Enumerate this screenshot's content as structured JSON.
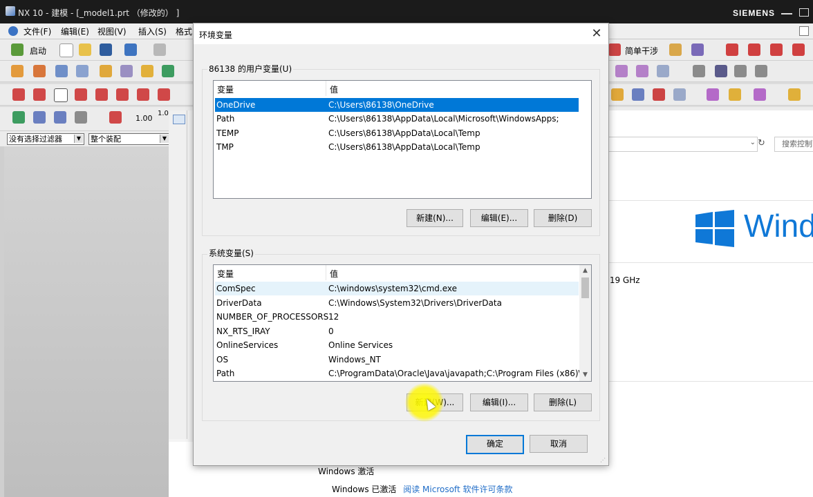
{
  "nx_window": {
    "title": "NX 10 - 建模 - [_model1.prt （修改的） ]",
    "brand": "SIEMENS",
    "menu": [
      "文件(F)",
      "编辑(E)",
      "视图(V)",
      "插入(S)",
      "格式"
    ],
    "toolbar": {
      "start_label": "启动",
      "simple_interference": "简单干涉",
      "scale_a": "1.00",
      "scale_b": "1.00"
    },
    "filter": {
      "selection_filter": "没有选择过滤器",
      "scope": "整个装配"
    }
  },
  "background_window": {
    "search_placeholder": "搜索控制面板",
    "windows_logo_text": "Wind",
    "cpu_speed_fragment": ".19 GHz",
    "activation_title": "Windows 激活",
    "activation_status": "Windows 已激活",
    "license_link": "阅读 Microsoft 软件许可条款"
  },
  "dialog": {
    "title": "环境变量",
    "user_section": {
      "label": "86138 的用户变量(U)",
      "columns": [
        "变量",
        "值"
      ],
      "rows": [
        {
          "name": "OneDrive",
          "value": "C:\\Users\\86138\\OneDrive",
          "selected": true
        },
        {
          "name": "Path",
          "value": "C:\\Users\\86138\\AppData\\Local\\Microsoft\\WindowsApps;"
        },
        {
          "name": "TEMP",
          "value": "C:\\Users\\86138\\AppData\\Local\\Temp"
        },
        {
          "name": "TMP",
          "value": "C:\\Users\\86138\\AppData\\Local\\Temp"
        }
      ],
      "buttons": {
        "new": "新建(N)...",
        "edit": "编辑(E)...",
        "delete": "删除(D)"
      }
    },
    "system_section": {
      "label": "系统变量(S)",
      "columns": [
        "变量",
        "值"
      ],
      "rows": [
        {
          "name": "ComSpec",
          "value": "C:\\windows\\system32\\cmd.exe"
        },
        {
          "name": "DriverData",
          "value": "C:\\Windows\\System32\\Drivers\\DriverData"
        },
        {
          "name": "NUMBER_OF_PROCESSORS",
          "value": "12"
        },
        {
          "name": "NX_RTS_IRAY",
          "value": "0"
        },
        {
          "name": "OnlineServices",
          "value": "Online Services"
        },
        {
          "name": "OS",
          "value": "Windows_NT"
        },
        {
          "name": "Path",
          "value": "C:\\ProgramData\\Oracle\\Java\\javapath;C:\\Program Files (x86)\\..."
        }
      ],
      "buttons": {
        "new": "新建(W)...",
        "edit": "编辑(I)...",
        "delete": "删除(L)"
      }
    },
    "ok": "确定",
    "cancel": "取消",
    "colors": {
      "selection": "#0078d7",
      "accent": "#0078d7"
    }
  }
}
